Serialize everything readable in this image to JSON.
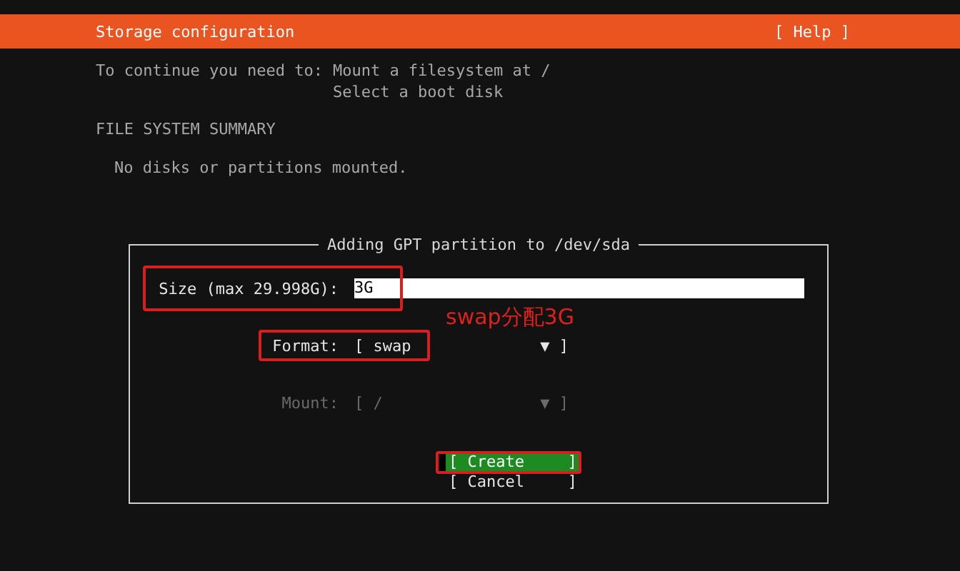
{
  "header": {
    "title": "Storage configuration",
    "help": "[ Help ]"
  },
  "requirements": {
    "label": "To continue you need to:",
    "items": [
      "Mount a filesystem at /",
      "Select a boot disk"
    ]
  },
  "summary": {
    "heading": "FILE SYSTEM SUMMARY",
    "empty_text": "No disks or partitions mounted."
  },
  "dialog": {
    "title": "Adding GPT partition to /dev/sda",
    "fields": [
      {
        "kind": "text",
        "label": "Size (max 29.998G):",
        "value": "3G",
        "disabled": false,
        "highlighted": true
      },
      {
        "kind": "note",
        "text": "swap分配3G"
      },
      {
        "kind": "dropdown",
        "label": "Format:",
        "open_bracket": "[",
        "value": "swap",
        "caret": "▼",
        "close_bracket": "]",
        "disabled": false,
        "highlighted": true
      },
      {
        "kind": "dropdown",
        "label": "Mount:",
        "open_bracket": "[",
        "value": "/",
        "caret": "▼",
        "close_bracket": "]",
        "disabled": true,
        "highlighted": false
      }
    ],
    "buttons": [
      {
        "open_bracket": "[",
        "label": "Create",
        "close_bracket": "]",
        "selected": true,
        "highlighted": true
      },
      {
        "open_bracket": "[",
        "label": "Cancel",
        "close_bracket": "]",
        "selected": false,
        "highlighted": false
      }
    ]
  }
}
